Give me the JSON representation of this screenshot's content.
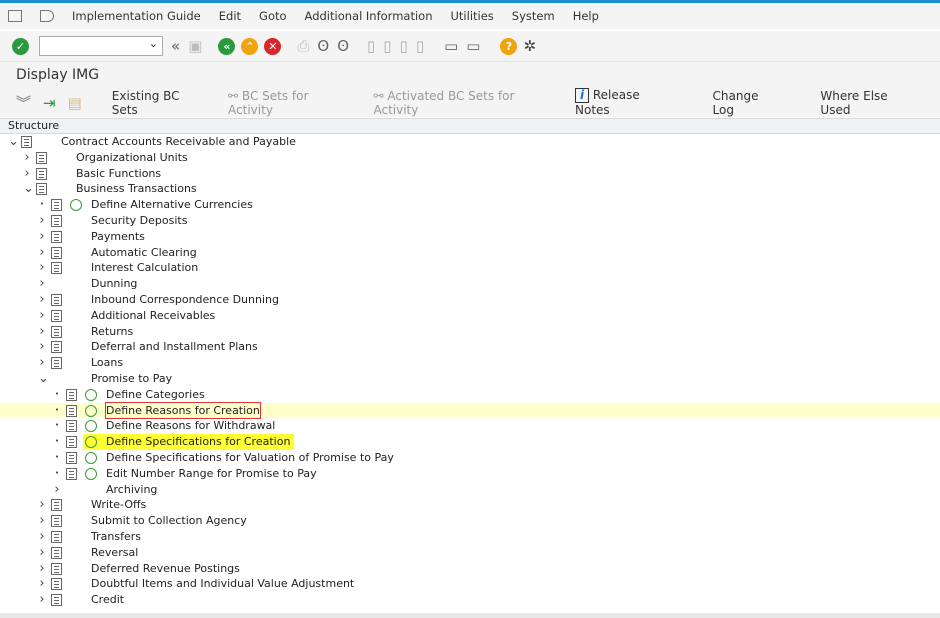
{
  "menu": [
    "Implementation Guide",
    "Edit",
    "Goto",
    "Additional Information",
    "Utilities",
    "System",
    "Help"
  ],
  "screen_title": "Display IMG",
  "app_toolbar": [
    {
      "label": "Existing BC Sets",
      "enabled": true
    },
    {
      "label": "BC Sets for Activity",
      "enabled": false,
      "icon": "glasses-icon"
    },
    {
      "label": "Activated BC Sets for Activity",
      "enabled": false,
      "icon": "glasses-icon"
    },
    {
      "label": "Release Notes",
      "enabled": true,
      "icon": "info-icon"
    },
    {
      "label": "Change Log",
      "enabled": true
    },
    {
      "label": "Where Else Used",
      "enabled": true
    }
  ],
  "structure_header": "Structure",
  "colors": {
    "accent": "#1a8fd8",
    "highlight": "#ffff33",
    "selected_row": "#ffffcc"
  },
  "tree": [
    {
      "level": 0,
      "exp": "open",
      "doc": true,
      "clock": false,
      "text": "Contract Accounts Receivable and Payable"
    },
    {
      "level": 1,
      "exp": "closed",
      "doc": true,
      "clock": false,
      "text": "Organizational Units"
    },
    {
      "level": 1,
      "exp": "closed",
      "doc": true,
      "clock": false,
      "text": "Basic Functions"
    },
    {
      "level": 1,
      "exp": "open",
      "doc": true,
      "clock": false,
      "text": "Business Transactions"
    },
    {
      "level": 2,
      "exp": "dot",
      "doc": true,
      "clock": true,
      "text": "Define Alternative Currencies"
    },
    {
      "level": 2,
      "exp": "closed",
      "doc": true,
      "clock": false,
      "text": "Security Deposits"
    },
    {
      "level": 2,
      "exp": "closed",
      "doc": true,
      "clock": false,
      "text": "Payments"
    },
    {
      "level": 2,
      "exp": "closed",
      "doc": true,
      "clock": false,
      "text": "Automatic Clearing"
    },
    {
      "level": 2,
      "exp": "closed",
      "doc": true,
      "clock": false,
      "text": "Interest Calculation"
    },
    {
      "level": 2,
      "exp": "closed",
      "doc": false,
      "clock": false,
      "text": "Dunning"
    },
    {
      "level": 2,
      "exp": "closed",
      "doc": true,
      "clock": false,
      "text": "Inbound Correspondence Dunning"
    },
    {
      "level": 2,
      "exp": "closed",
      "doc": true,
      "clock": false,
      "text": "Additional Receivables"
    },
    {
      "level": 2,
      "exp": "closed",
      "doc": true,
      "clock": false,
      "text": "Returns"
    },
    {
      "level": 2,
      "exp": "closed",
      "doc": true,
      "clock": false,
      "text": "Deferral and Installment Plans"
    },
    {
      "level": 2,
      "exp": "closed",
      "doc": true,
      "clock": false,
      "text": "Loans"
    },
    {
      "level": 2,
      "exp": "open",
      "doc": false,
      "clock": false,
      "text": "Promise to Pay"
    },
    {
      "level": 3,
      "exp": "dot",
      "doc": true,
      "clock": true,
      "text": "Define Categories"
    },
    {
      "level": 3,
      "exp": "dot",
      "doc": true,
      "clock": true,
      "text": "Define Reasons for Creation",
      "selected": true
    },
    {
      "level": 3,
      "exp": "dot",
      "doc": true,
      "clock": true,
      "text": "Define Reasons for Withdrawal"
    },
    {
      "level": 3,
      "exp": "dot",
      "doc": true,
      "clock": true,
      "text": "Define Specifications for Creation",
      "highlight": true
    },
    {
      "level": 3,
      "exp": "dot",
      "doc": true,
      "clock": true,
      "text": "Define Specifications for Valuation of Promise to Pay"
    },
    {
      "level": 3,
      "exp": "dot",
      "doc": true,
      "clock": true,
      "text": "Edit Number Range for Promise to Pay"
    },
    {
      "level": 3,
      "exp": "closed",
      "doc": false,
      "clock": false,
      "text": "Archiving"
    },
    {
      "level": 2,
      "exp": "closed",
      "doc": true,
      "clock": false,
      "text": "Write-Offs"
    },
    {
      "level": 2,
      "exp": "closed",
      "doc": true,
      "clock": false,
      "text": "Submit to Collection Agency"
    },
    {
      "level": 2,
      "exp": "closed",
      "doc": true,
      "clock": false,
      "text": "Transfers"
    },
    {
      "level": 2,
      "exp": "closed",
      "doc": true,
      "clock": false,
      "text": "Reversal"
    },
    {
      "level": 2,
      "exp": "closed",
      "doc": true,
      "clock": false,
      "text": "Deferred Revenue Postings"
    },
    {
      "level": 2,
      "exp": "closed",
      "doc": true,
      "clock": false,
      "text": "Doubtful Items and Individual Value Adjustment"
    },
    {
      "level": 2,
      "exp": "closed",
      "doc": true,
      "clock": false,
      "text": "Credit"
    }
  ]
}
